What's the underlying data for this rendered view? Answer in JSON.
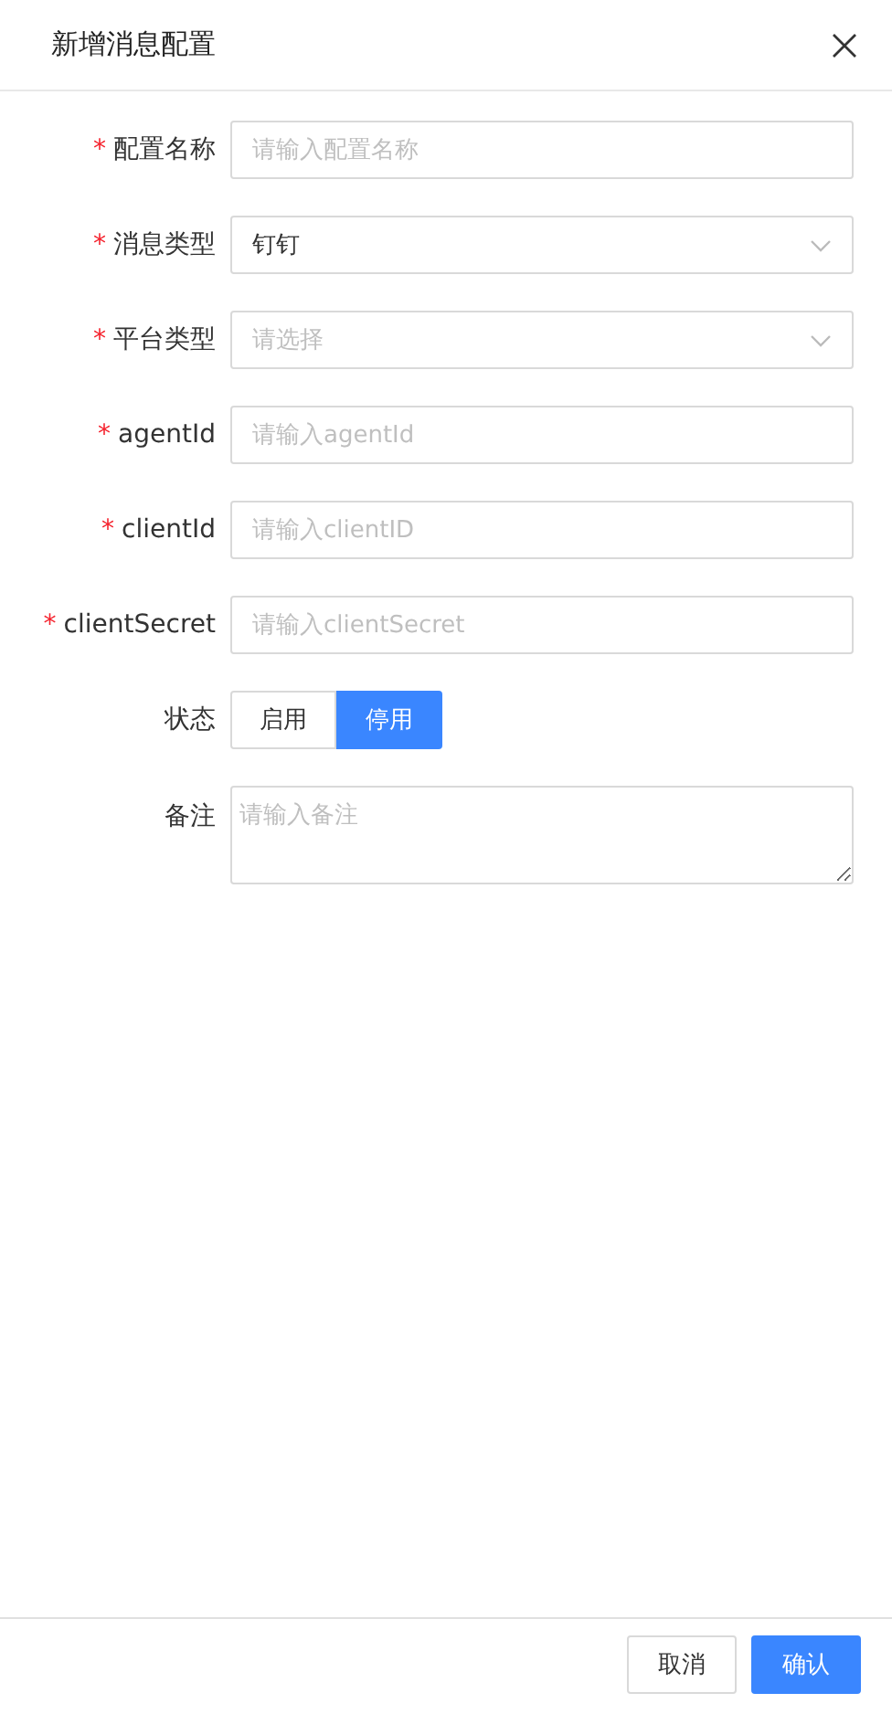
{
  "dialog": {
    "title": "新增消息配置"
  },
  "fields": [
    {
      "kind": "input",
      "label": "配置名称",
      "required_mark": "*",
      "placeholder": "请输入配置名称"
    },
    {
      "kind": "select",
      "label": "消息类型",
      "required_mark": "*",
      "value": "钉钉"
    },
    {
      "kind": "select",
      "label": "平台类型",
      "required_mark": "*",
      "placeholder": "请选择"
    },
    {
      "kind": "input",
      "label": "agentId",
      "required_mark": "*",
      "placeholder": "请输入agentId"
    },
    {
      "kind": "input",
      "label": "clientId",
      "required_mark": "*",
      "placeholder": "请输入clientID"
    },
    {
      "kind": "input",
      "label": "clientSecret",
      "required_mark": "*",
      "placeholder": "请输入clientSecret"
    },
    {
      "kind": "radio",
      "label": "状态",
      "options": [
        {
          "label": "启用",
          "selected": false
        },
        {
          "label": "停用",
          "selected": true
        }
      ]
    },
    {
      "kind": "textarea",
      "label": "备注",
      "placeholder": "请输入备注"
    }
  ],
  "buttons": [
    {
      "label": "取消",
      "primary": false
    },
    {
      "label": "确认",
      "primary": true
    }
  ]
}
